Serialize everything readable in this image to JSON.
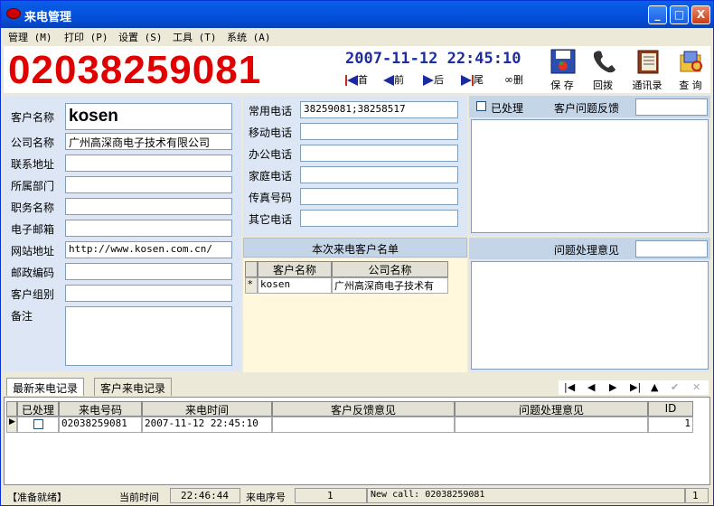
{
  "window": {
    "title": "来电管理",
    "minimize": "_",
    "maximize": "□",
    "close": "X"
  },
  "menu": [
    "管理 (M)",
    "打印 (P)",
    "设置 (S)",
    "工具 (T)",
    "系统 (A)"
  ],
  "header": {
    "phone_number": "02038259081",
    "datetime": "2007-11-12 22:45:10",
    "nav": {
      "first": "首",
      "prev": "前",
      "next": "后",
      "last": "尾",
      "delete": "删"
    },
    "toolbar": {
      "save": "保 存",
      "dialback": "回拨",
      "contacts": "通讯录",
      "query": "查 询"
    }
  },
  "customer": {
    "labels": [
      "客户名称",
      "公司名称",
      "联系地址",
      "所属部门",
      "职务名称",
      "电子邮箱",
      "网站地址",
      "邮政编码",
      "客户组别",
      "备注"
    ],
    "name": "kosen",
    "company": "广州高深商电子技术有限公司",
    "address": "",
    "department": "",
    "job_title": "",
    "email": "",
    "website": "http://www.kosen.com.cn/",
    "postcode": "",
    "group": "",
    "notes": ""
  },
  "phones": {
    "labels": [
      "常用电话",
      "移动电话",
      "办公电话",
      "家庭电话",
      "传真号码",
      "其它电话"
    ],
    "common": "38259081;38258517",
    "mobile": "",
    "office": "",
    "home": "",
    "fax": "",
    "other": ""
  },
  "feedback": {
    "processed_label": "已处理",
    "title": "客户问题反馈",
    "value": ""
  },
  "callers_list": {
    "title": "本次来电客户名单",
    "columns": [
      "客户名称",
      "公司名称"
    ],
    "rows": [
      {
        "marker": "*",
        "name": "kosen",
        "company": "广州高深商电子技术有"
      }
    ]
  },
  "opinion": {
    "title": "问题处理意见",
    "value": ""
  },
  "tabs": [
    "最新来电记录",
    "客户来电记录"
  ],
  "records_nav": [
    "|◀",
    "◀",
    "▶",
    "▶|",
    "▲",
    "✔",
    "✕"
  ],
  "records": {
    "columns": [
      "已处理",
      "来电号码",
      "来电时间",
      "客户反馈意见",
      "问题处理意见",
      "ID"
    ],
    "rows": [
      {
        "marker": "▶",
        "processed": false,
        "number": "02038259081",
        "time": "2007-11-12 22:45:10",
        "feedback": "",
        "opinion": "",
        "id": "1"
      }
    ]
  },
  "status": {
    "ready": "【准备就绪】",
    "current_time_label": "当前时间",
    "current_time": "22:46:44",
    "seq_label": "来电序号",
    "seq": "1",
    "message": "New call: 02038259081",
    "count": "1"
  },
  "colors": {
    "phone": "#e00000",
    "datetime": "#1e2ea0",
    "panel": "#dce6f4",
    "titlebar": "#0554e0"
  }
}
